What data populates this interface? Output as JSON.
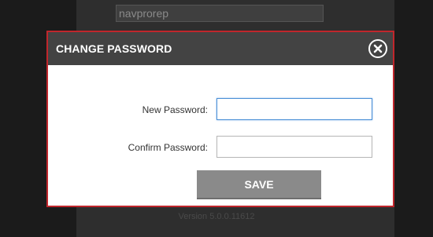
{
  "background": {
    "username_value": "navprorep",
    "version_text": "Version 5.0.0.11612"
  },
  "dialog": {
    "title": "CHANGE PASSWORD",
    "close_icon": "close-circle-x",
    "new_password_label": "New Password:",
    "new_password_value": "",
    "confirm_password_label": "Confirm Password:",
    "confirm_password_value": "",
    "save_label": "SAVE"
  },
  "colors": {
    "header": "#434343",
    "border_accent": "#c0262c",
    "save_button": "#8a8a8a",
    "focus_border": "#4a8fd6"
  }
}
